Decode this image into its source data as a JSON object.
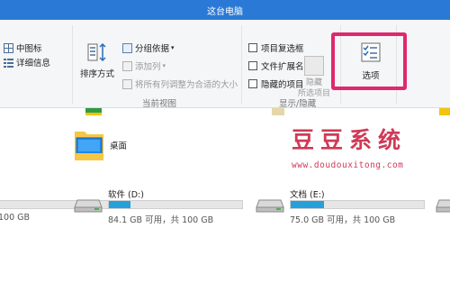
{
  "window": {
    "title": "这台电脑"
  },
  "ribbon": {
    "layout": {
      "medium_icons": "中图标",
      "details": "详细信息"
    },
    "current_view": {
      "sort_by": "排序方式",
      "group_by": "分组依据",
      "add_column": "添加列",
      "fit_columns": "将所有列调整为合适的大小",
      "group_label": "当前视图"
    },
    "show_hide": {
      "item_checkboxes": "项目复选框",
      "file_extensions": "文件扩展名",
      "hidden_items": "隐藏的项目",
      "hide_selected_line1": "隐藏",
      "hide_selected_line2": "所选项目",
      "group_label": "显示/隐藏"
    },
    "options": {
      "label": "选项"
    }
  },
  "content": {
    "desktop_folder": "桌面",
    "drives": [
      {
        "name": "",
        "info": "100 GB",
        "fill_percent": 0
      },
      {
        "name": "软件 (D:)",
        "info": "84.1 GB 可用，共 100 GB",
        "fill_percent": 16
      },
      {
        "name": "文档 (E:)",
        "info": "75.0 GB 可用，共 100 GB",
        "fill_percent": 25
      },
      {
        "name": "",
        "info": "",
        "fill_percent": 0
      }
    ]
  },
  "watermark": {
    "title": "豆豆系统",
    "url": "www.doudouxitong.com"
  },
  "colors": {
    "titlebar": "#2b79d6",
    "highlight": "#e0286e",
    "progress": "#26a0da",
    "watermark": "#cf3a57"
  }
}
